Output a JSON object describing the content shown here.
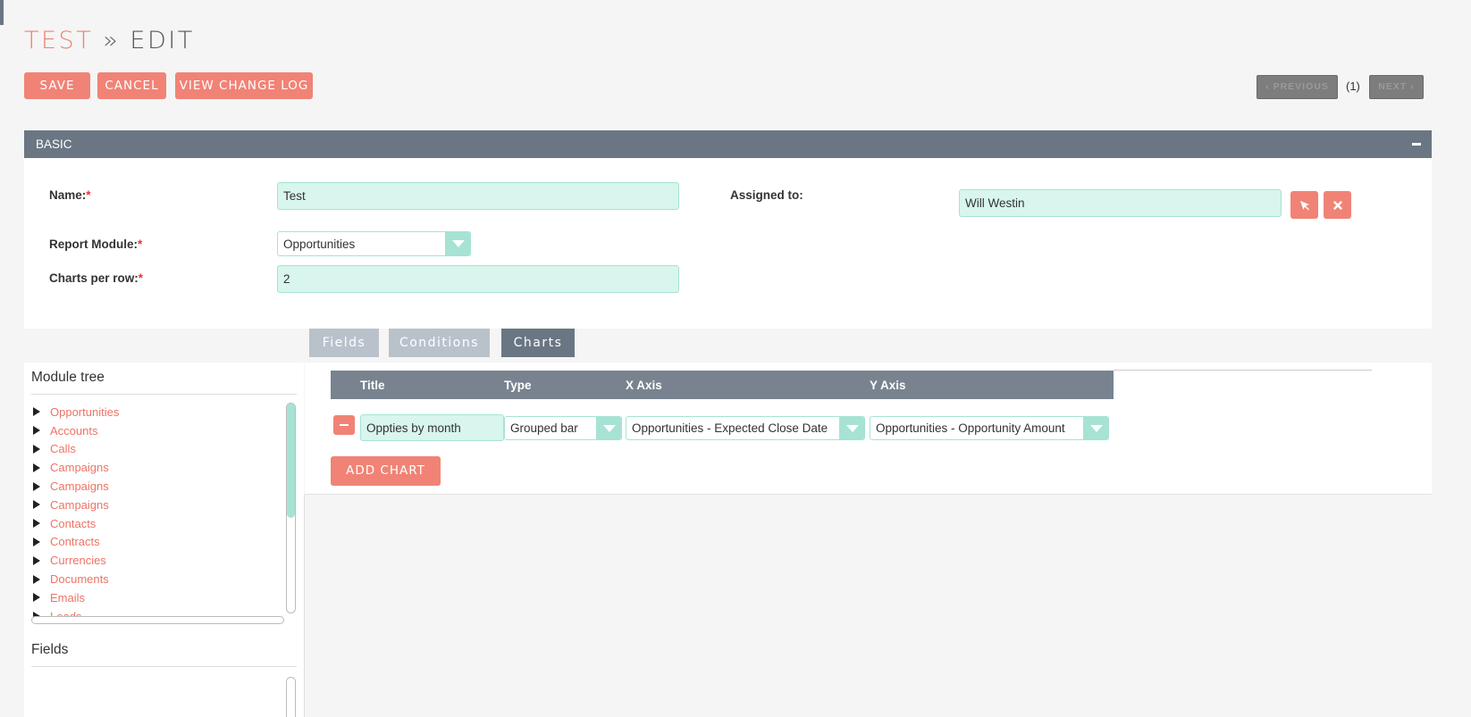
{
  "header": {
    "module": "TEST",
    "separator": "»",
    "action": "EDIT"
  },
  "actions": {
    "save": "SAVE",
    "cancel": "CANCEL",
    "view_change_log": "VIEW CHANGE LOG"
  },
  "pagination": {
    "previous": "PREVIOUS",
    "count": "(1)",
    "next": "NEXT"
  },
  "panel": {
    "title": "BASIC"
  },
  "form": {
    "name_label": "Name:",
    "name_value": "Test",
    "report_module_label": "Report Module:",
    "report_module_value": "Opportunities",
    "charts_per_row_label": "Charts per row:",
    "charts_per_row_value": "2",
    "assigned_to_label": "Assigned to:",
    "assigned_to_value": "Will Westin",
    "required_mark": "*"
  },
  "tabs": [
    {
      "label": "Fields",
      "active": false
    },
    {
      "label": "Conditions",
      "active": false
    },
    {
      "label": "Charts",
      "active": true
    }
  ],
  "module_tree": {
    "title": "Module tree",
    "items": [
      "Opportunities",
      "Accounts",
      "Calls",
      "Campaigns",
      "Campaigns",
      "Campaigns",
      "Contacts",
      "Contracts",
      "Currencies",
      "Documents",
      "Emails",
      "Leads"
    ]
  },
  "fields_section": {
    "title": "Fields"
  },
  "charts_table": {
    "columns": {
      "title": "Title",
      "type": "Type",
      "x_axis": "X Axis",
      "y_axis": "Y Axis"
    },
    "rows": [
      {
        "title": "Oppties by month",
        "type": "Grouped bar",
        "x_axis": "Opportunities - Expected Close Date",
        "y_axis": "Opportunities - Opportunity Amount"
      }
    ],
    "add_chart": "ADD CHART"
  },
  "colors": {
    "accent": "#f08376",
    "header": "#6a7683",
    "field_bg": "#d8f5ee",
    "field_border": "#a6e3d4"
  },
  "icons": {
    "select_user": "cursor-arrow-icon",
    "clear_user": "close-icon",
    "remove_chart": "minus-icon",
    "collapse_panel": "minus-icon",
    "tree_expand": "triangle-right-icon"
  }
}
